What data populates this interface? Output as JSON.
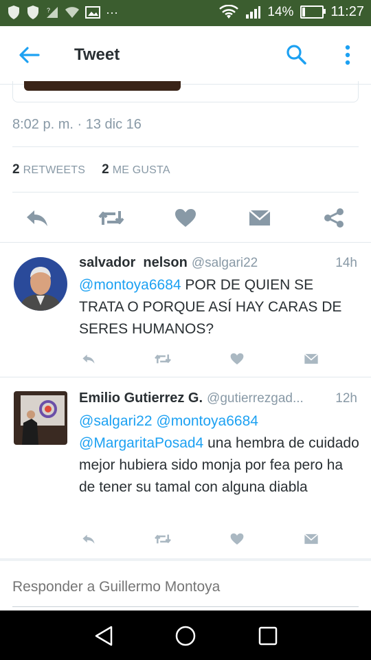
{
  "status_bar": {
    "battery": "14%",
    "time": "11:27",
    "battery_level": 0.14,
    "overflow": "···"
  },
  "app_bar": {
    "title": "Tweet"
  },
  "main_tweet": {
    "timestamp": "8:02 p. m. · 13 dic 16",
    "retweets_count": "2",
    "retweets_label": "RETWEETS",
    "likes_count": "2",
    "likes_label": "ME GUSTA"
  },
  "replies": [
    {
      "name": "salvador  nelson",
      "handle": "@salgari22",
      "time": "14h",
      "mentions": "@montoya6684",
      "text": " POR DE QUIEN SE TRATA O PORQUE ASÍ HAY CARAS DE SERES HUMANOS?"
    },
    {
      "name": "Emilio Gutierrez G.",
      "handle": "@gutierrezgad...",
      "time": "12h",
      "mentions": "@salgari22 @montoya6684 @MargaritaPosad4",
      "text": " una hembra de cuidado mejor hubiera sido monja por fea pero ha de tener su tamal con alguna diabla"
    }
  ],
  "reply_box": {
    "placeholder": "Responder a Guillermo Montoya"
  },
  "colors": {
    "status_bar": "#3b5d2f",
    "accent": "#1da1f2",
    "icon_gray": "#8899a6",
    "text": "#292f33"
  },
  "icons": [
    "shield-icon",
    "wifi-icon",
    "signal-icon",
    "image-icon",
    "battery-icon",
    "back-arrow-icon",
    "search-icon",
    "more-vert-icon",
    "reply-icon",
    "retweet-icon",
    "heart-icon",
    "message-icon",
    "share-icon",
    "nav-back-icon",
    "nav-home-icon",
    "nav-recents-icon"
  ]
}
